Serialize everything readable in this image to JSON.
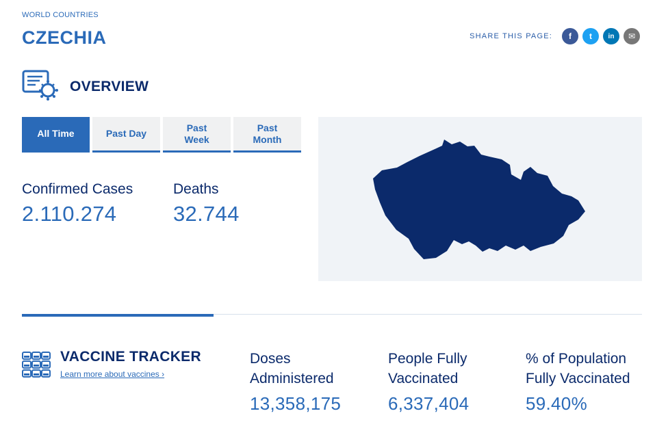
{
  "breadcrumb": "WORLD COUNTRIES",
  "country": "CZECHIA",
  "share": {
    "label": "SHARE THIS PAGE:",
    "buttons": [
      {
        "icon": "facebook-icon",
        "glyph": "f"
      },
      {
        "icon": "twitter-icon",
        "glyph": "t"
      },
      {
        "icon": "linkedin-icon",
        "glyph": "in"
      },
      {
        "icon": "email-icon",
        "glyph": "✉"
      }
    ]
  },
  "overview": {
    "title": "OVERVIEW",
    "icon": "overview-virus-report-icon",
    "tabs": [
      "All Time",
      "Past Day",
      "Past\nWeek",
      "Past\nMonth"
    ],
    "active_tab": "All Time",
    "confirmed_label": "Confirmed Cases",
    "confirmed_value": "2.110.274",
    "deaths_label": "Deaths",
    "deaths_value": "32.744",
    "map_icon": "czechia-map-shape"
  },
  "vaccine": {
    "title": "VACCINE TRACKER",
    "icon": "vaccine-vials-icon",
    "link": "Learn more about vaccines ›",
    "doses_label": "Doses\nAdministered",
    "doses_value": "13,358,175",
    "people_label": "People Fully\nVaccinated",
    "people_value": "6,337,404",
    "pct_label": "% of Population\nFully Vaccinated",
    "pct_value": "59.40%"
  },
  "colors": {
    "accent": "#2a6ab8",
    "navy": "#0b2a6b",
    "map_fill": "#0b2a6b",
    "map_bg": "#f0f3f7"
  }
}
